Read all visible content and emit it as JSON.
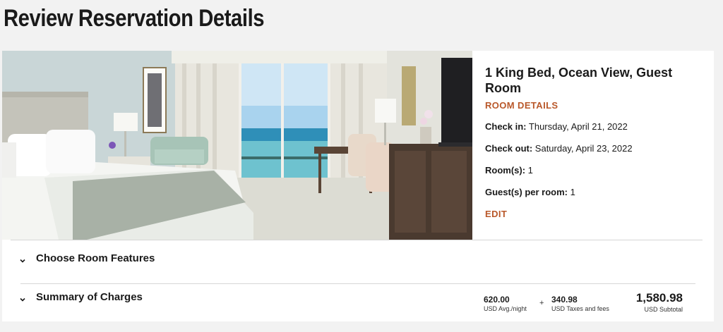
{
  "page": {
    "title": "Review Reservation Details"
  },
  "room": {
    "name": "1 King Bed, Ocean View, Guest Room",
    "details_link": "ROOM DETAILS",
    "check_in_label": "Check in:",
    "check_in_value": "Thursday, April 21, 2022",
    "check_out_label": "Check out:",
    "check_out_value": "Saturday, April 23, 2022",
    "rooms_label": "Room(s):",
    "rooms_value": "1",
    "guests_label": "Guest(s) per room:",
    "guests_value": "1",
    "edit_link": "EDIT"
  },
  "accordion": {
    "features_label": "Choose Room Features",
    "summary_label": "Summary of Charges"
  },
  "charges": {
    "avg_night_value": "620.00",
    "avg_night_label": "USD Avg./night",
    "plus": "+",
    "taxes_value": "340.98",
    "taxes_label": "USD Taxes and fees",
    "subtotal_value": "1,580.98",
    "subtotal_label": "USD Subtotal"
  },
  "icons": {
    "chevron": "chevron-down-icon"
  },
  "colors": {
    "accent": "#b9582a",
    "background": "#f2f2f2"
  }
}
